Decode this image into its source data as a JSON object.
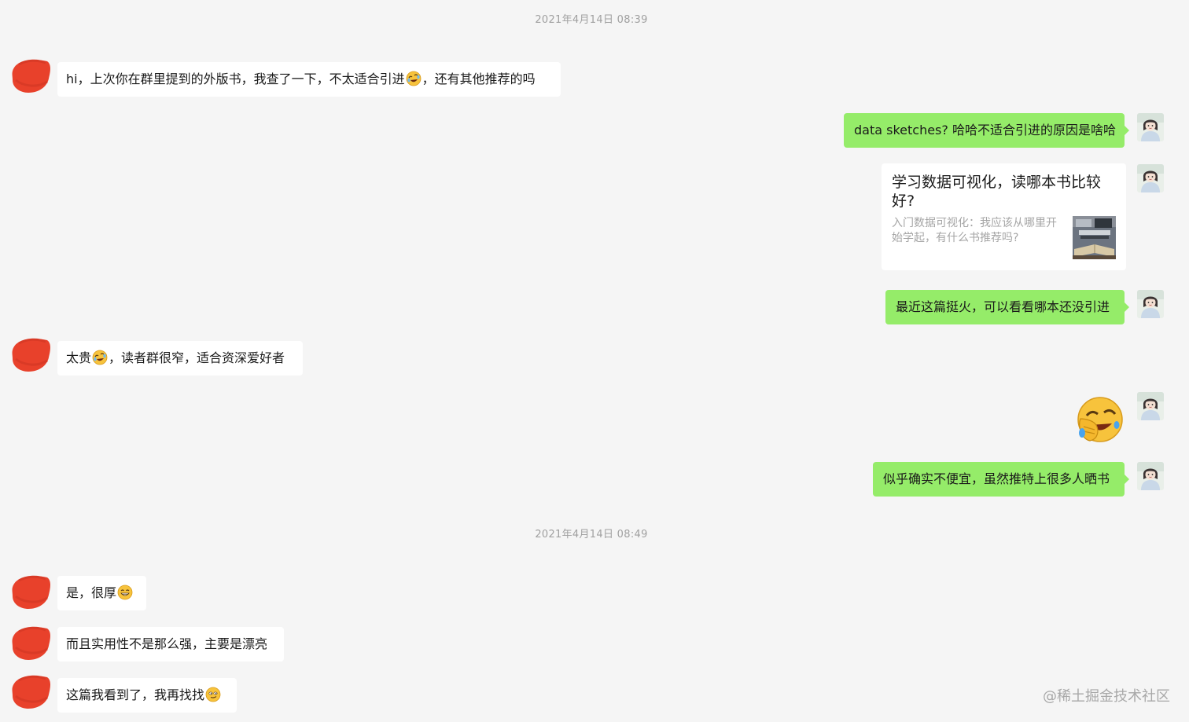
{
  "timestamps": [
    "2021年4月14日 08:39",
    "2021年4月14日 08:49"
  ],
  "messages": {
    "m1": {
      "before": "hi，上次你在群里提到的外版书，我查了一下，不太适合引进",
      "emoji": "rolling-laughing-emoji",
      "after": "，还有其他推荐的吗"
    },
    "m2": {
      "text": "data sketches? 哈哈不适合引进的原因是啥哈"
    },
    "m3": {
      "card_title": "学习数据可视化，读哪本书比较好?",
      "card_desc": "入门数据可视化：我应该从哪里开始学起，有什么书推荐吗?",
      "thumb_icon": "book-thumbnail"
    },
    "m4": {
      "text": "最近这篇挺火，可以看看哪本还没引进"
    },
    "m5": {
      "before": "太贵",
      "emoji": "rolling-laughing-emoji",
      "after": "，读者群很窄，适合资深爱好者"
    },
    "m6": {
      "emoji": "facepalm-laughing-emoji"
    },
    "m7": {
      "text": "似乎确实不便宜，虽然推特上很多人晒书"
    },
    "m8": {
      "before": "是，很厚",
      "emoji": "grin-emoji"
    },
    "m9": {
      "text": "而且实用性不是那么强，主要是漂亮"
    },
    "m10": {
      "before": "这篇我看到了，我再找找",
      "emoji": "smirk-emoji"
    }
  },
  "watermark": "@稀土掘金技术社区",
  "colors": {
    "background": "#f5f5f5",
    "outgoing_bubble": "#95ec69",
    "incoming_bubble": "#ffffff",
    "redaction": "#e8412b",
    "timestamp_text": "#a0a0a0"
  }
}
